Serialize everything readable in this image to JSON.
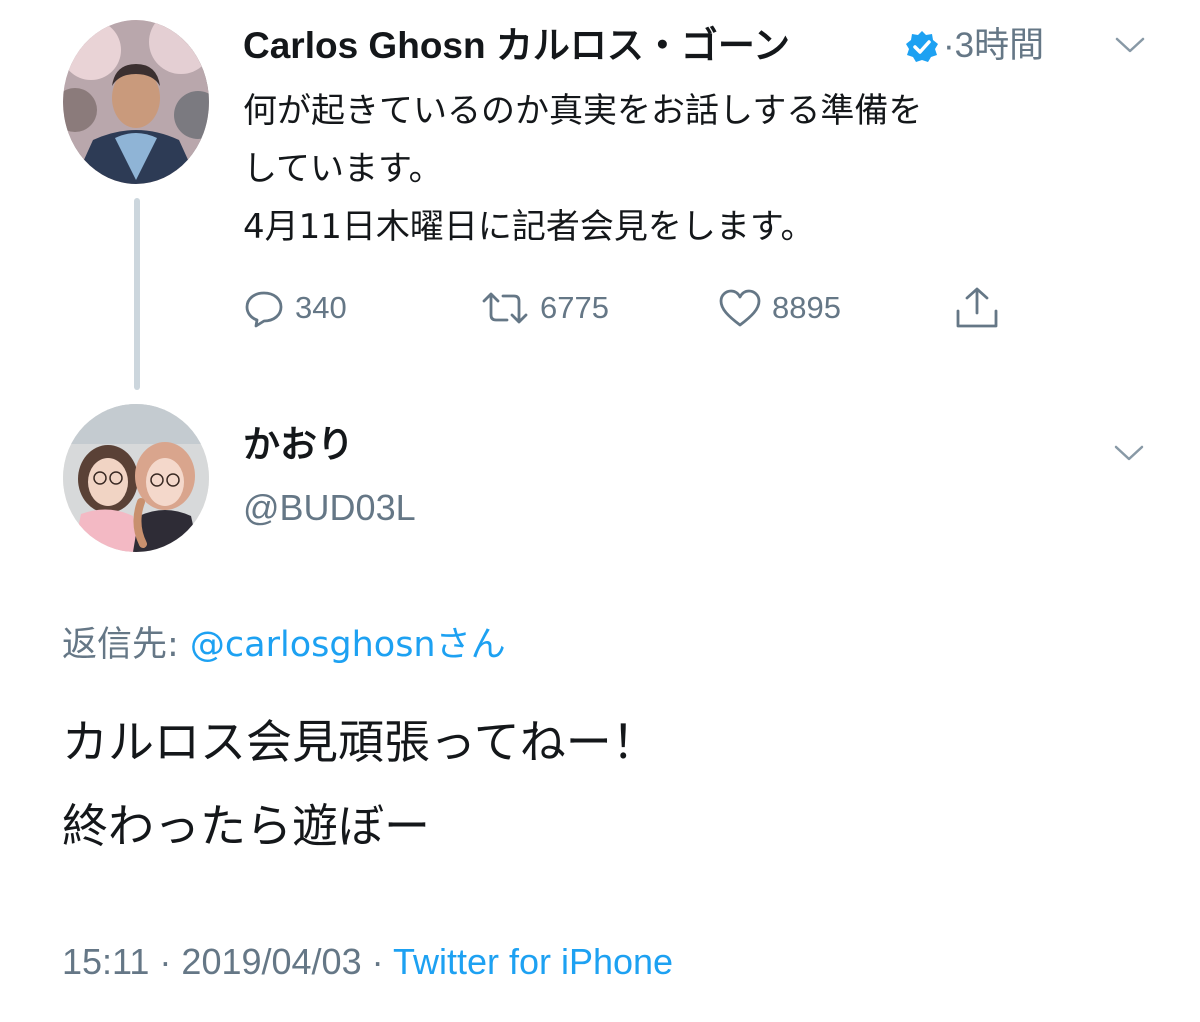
{
  "thread": {
    "original_tweet": {
      "display_name": "Carlos Ghosn カルロス・ゴーン",
      "verified_icon": "verified-badge-icon",
      "separator": "·",
      "time": "3時間",
      "body_lines": [
        "何が起きているのか真実をお話しする準備を",
        "しています。",
        "4月11日木曜日に記者会見をします。"
      ],
      "actions": {
        "reply_count": "340",
        "retweet_count": "6775",
        "like_count": "8895"
      }
    },
    "reply_tweet": {
      "display_name": "かおり",
      "handle": "@BUD03L",
      "replying_to_label": "返信先: ",
      "replying_to_mention": "@carlosghosnさん",
      "body_lines": [
        "カルロス会見頑張ってねー！",
        "終わったら遊ぼー"
      ],
      "time": "15:11",
      "separator_1": " · ",
      "date": "2019/04/03",
      "separator_2": " · ",
      "source": "Twitter for iPhone"
    }
  },
  "colors": {
    "text": "#14171a",
    "secondary": "#657786",
    "accent": "#1da1f2",
    "thread_line": "#ccd6dd"
  }
}
